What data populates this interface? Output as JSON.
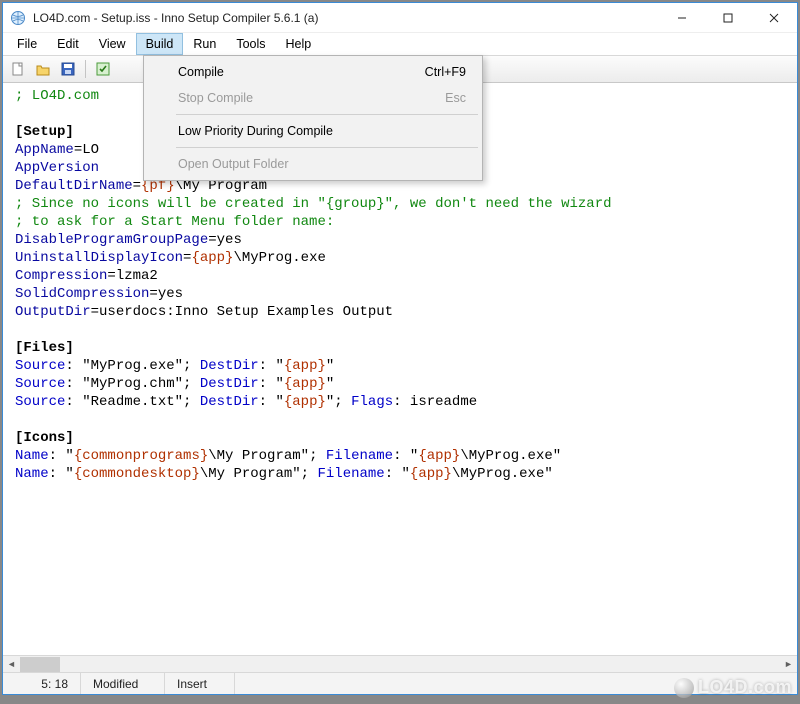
{
  "title": "LO4D.com - Setup.iss - Inno Setup Compiler 5.6.1 (a)",
  "menubar": [
    "File",
    "Edit",
    "View",
    "Build",
    "Run",
    "Tools",
    "Help"
  ],
  "active_menu_index": 3,
  "dropdown": {
    "items": [
      {
        "label": "Compile",
        "shortcut": "Ctrl+F9",
        "enabled": true
      },
      {
        "label": "Stop Compile",
        "shortcut": "Esc",
        "enabled": false
      },
      {
        "sep": true
      },
      {
        "label": "Low Priority During Compile",
        "shortcut": "",
        "enabled": true
      },
      {
        "sep": true
      },
      {
        "label": "Open Output Folder",
        "shortcut": "",
        "enabled": false
      }
    ]
  },
  "toolbar_icons": [
    "new-file",
    "open-folder",
    "save",
    "separator",
    "compile"
  ],
  "status": {
    "pos": "5:  18",
    "modified": "Modified",
    "insert": "Insert"
  },
  "code_lines": [
    {
      "t": "cmt",
      "text": "; LO4D.com"
    },
    {
      "t": "blank",
      "text": ""
    },
    {
      "t": "sec",
      "text": "[Setup]"
    },
    {
      "t": "kv",
      "k": "AppName",
      "v": "=LO"
    },
    {
      "t": "kv",
      "k": "AppVersion",
      "v": ""
    },
    {
      "t": "kvcon",
      "k": "DefaultDirName",
      "pre": "=",
      "con": "{pf}",
      "post": "\\My Program"
    },
    {
      "t": "cmt",
      "text": "; Since no icons will be created in \"{group}\", we don't need the wizard"
    },
    {
      "t": "cmt",
      "text": "; to ask for a Start Menu folder name:"
    },
    {
      "t": "kv",
      "k": "DisableProgramGroupPage",
      "v": "=yes"
    },
    {
      "t": "kvcon",
      "k": "UninstallDisplayIcon",
      "pre": "=",
      "con": "{app}",
      "post": "\\MyProg.exe"
    },
    {
      "t": "kv",
      "k": "Compression",
      "v": "=lzma2"
    },
    {
      "t": "kv",
      "k": "SolidCompression",
      "v": "=yes"
    },
    {
      "t": "kv",
      "k": "OutputDir",
      "v": "=userdocs:Inno Setup Examples Output"
    },
    {
      "t": "blank",
      "text": ""
    },
    {
      "t": "sec",
      "text": "[Files]"
    },
    {
      "t": "file",
      "src": "\"MyProg.exe\"",
      "dest": "\"{app}\"",
      "flags": null
    },
    {
      "t": "file",
      "src": "\"MyProg.chm\"",
      "dest": "\"{app}\"",
      "flags": null
    },
    {
      "t": "file",
      "src": "\"Readme.txt\"",
      "dest": "\"{app}\"",
      "flags": "isreadme"
    },
    {
      "t": "blank",
      "text": ""
    },
    {
      "t": "sec",
      "text": "[Icons]"
    },
    {
      "t": "icon",
      "con": "{commonprograms}",
      "path": "\\My Program\"",
      "file": "\"{app}\\MyProg.exe\""
    },
    {
      "t": "icon",
      "con": "{commondesktop}",
      "path": "\\My Program\"",
      "file": "\"{app}\\MyProg.exe\""
    }
  ],
  "watermark": "LO4D.com"
}
